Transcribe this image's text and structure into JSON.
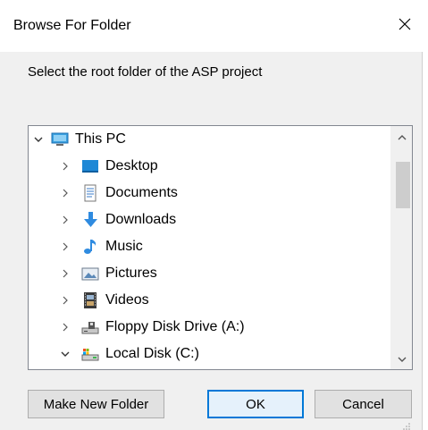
{
  "window": {
    "title": "Browse For Folder",
    "close_icon": "close-icon"
  },
  "description": "Select the root folder of the ASP project",
  "tree": {
    "items": [
      {
        "label": "This PC",
        "expanded": true,
        "level": 0,
        "icon": "computer-icon"
      },
      {
        "label": "Desktop",
        "expanded": false,
        "level": 1,
        "icon": "desktop-icon"
      },
      {
        "label": "Documents",
        "expanded": false,
        "level": 1,
        "icon": "documents-icon"
      },
      {
        "label": "Downloads",
        "expanded": false,
        "level": 1,
        "icon": "downloads-icon"
      },
      {
        "label": "Music",
        "expanded": false,
        "level": 1,
        "icon": "music-icon"
      },
      {
        "label": "Pictures",
        "expanded": false,
        "level": 1,
        "icon": "pictures-icon"
      },
      {
        "label": "Videos",
        "expanded": false,
        "level": 1,
        "icon": "videos-icon"
      },
      {
        "label": "Floppy Disk Drive (A:)",
        "expanded": false,
        "level": 1,
        "icon": "floppy-drive-icon"
      },
      {
        "label": "Local Disk (C:)",
        "expanded": true,
        "level": 1,
        "icon": "local-disk-icon"
      }
    ]
  },
  "buttons": {
    "make_new_folder": "Make New Folder",
    "ok": "OK",
    "cancel": "Cancel"
  },
  "colors": {
    "accent": "#0078d7",
    "dialog_bg": "#f0f0f0",
    "button_bg": "#e1e1e1"
  }
}
